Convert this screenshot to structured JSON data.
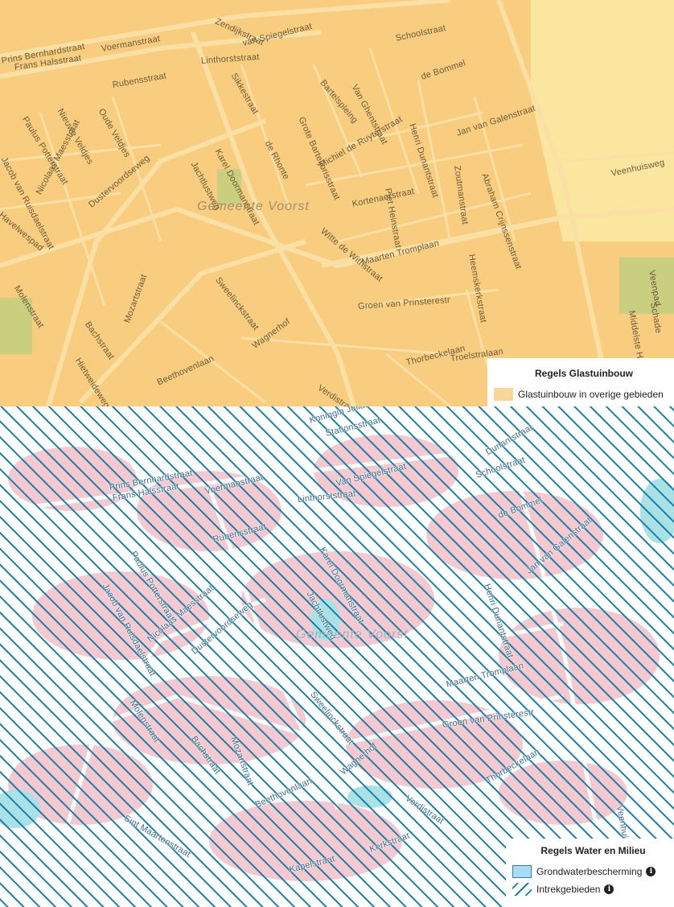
{
  "top_map": {
    "municipality_label": "Gemeente Voorst",
    "colors": {
      "background": "#f9cd7f",
      "roads": "#fbe0a6",
      "green": "#c9cf7f",
      "light_area": "#fbe6a0"
    },
    "streets": [
      "Prins Bernhardstraat",
      "Frans Halsstraat",
      "Voermanstraat",
      "Zendijkstraat",
      "van Spiegelstraat",
      "Schoolstraat",
      "de Bommel",
      "Linthorststraat",
      "Rubensstraat",
      "Oude Veldjes",
      "Nieuwe Veldjes",
      "Paulus Potterstraat",
      "Jacob van Ruisdaelstraat",
      "Nicolaas Maesstraat",
      "Dustervoordseweg",
      "Havelwespad",
      "Sikkestraat",
      "Bartelspleing",
      "Van Ghentstraat",
      "Henri Dunantstraat",
      "Jan van Galenstraat",
      "Zoutmanstraat",
      "Abraham Crijnssenstraat",
      "Jachtlustweg",
      "Karel Doormanstraat",
      "de Rhonte",
      "Grote Barteljorisstraat",
      "Michiel de Ruyterstraat",
      "Piet Heinstraat",
      "Veenhuisweg",
      "Kortenaerstraat",
      "Witte de Withstraat",
      "Maarten Tromplaan",
      "Heemskerkstraat",
      "Sweelinckstraat",
      "Molenstraat",
      "Mozartstraat",
      "Bachstraat",
      "Hietweideweg",
      "Groen van Prinsterestr",
      "Wagnerhof",
      "Thorbeckelaan",
      "Troelstralaan",
      "Beethovenlaan",
      "Verdistraat",
      "Middelste Hoeve",
      "Schade",
      "Veenpad"
    ]
  },
  "bottom_map": {
    "municipality_label": "Gemeente Voorst",
    "colors": {
      "hatch": "#1a7fa6",
      "pink": "#f5c9cf",
      "cyan": "#a9e1e6"
    },
    "streets": [
      "Stationsstraat",
      "Koningin Julianastraat",
      "Schoolstraat",
      "Dunantstraat",
      "Voermanstraat",
      "Frans Halsstraat",
      "Prins Bernhardstraat",
      "Linthorststraat",
      "Van Spiegelstraat",
      "Rubensstraat",
      "Paulus Potterstraat",
      "Jacob van Ruisdaelstraat",
      "Nicolaas Maesstraat",
      "Dustervoordseweg",
      "Jachtlustweg",
      "Karel Doormanstraat",
      "de Bommel",
      "Henri Dunantstraat",
      "Jan van Galenstraat",
      "Maarten Tromplaan",
      "Groen van Prinsterestr",
      "Sweelinckstraat",
      "Molenstraat",
      "Bachstraat",
      "Mozartstraat",
      "Wagnerhof",
      "Beethovenlaan",
      "Verdistraat",
      "Sint Maartenstraat",
      "Thorbeckelaan",
      "Kapelstraat",
      "Kerkstraat",
      "Veenhuisweg"
    ]
  },
  "legends": {
    "glastuinbouw": {
      "title": "Regels Glastuinbouw",
      "items": [
        {
          "label": "Glastuinbouw in overige gebieden",
          "color": "#f9d69a"
        }
      ]
    },
    "water_milieu": {
      "title": "Regels Water en Milieu",
      "items": [
        {
          "label": "Grondwaterbescherming",
          "color": "#a9dcf3",
          "icon": "info-icon"
        },
        {
          "label": "Intrekgebieden",
          "color": "#1a7fa6",
          "icon": "info-icon"
        }
      ]
    }
  }
}
